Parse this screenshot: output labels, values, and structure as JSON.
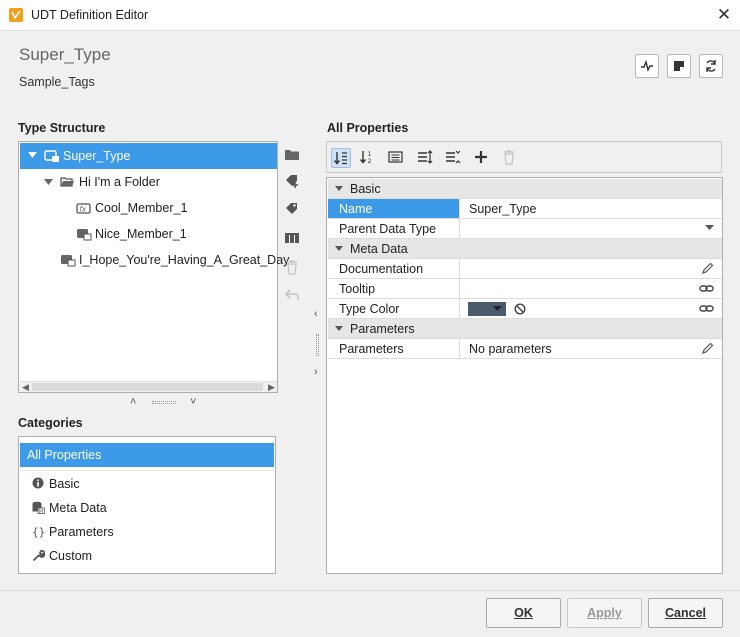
{
  "window": {
    "title": "UDT Definition Editor",
    "close": "✕"
  },
  "header": {
    "udt_name": "Super_Type",
    "tag_provider": "Sample_Tags"
  },
  "type_structure": {
    "label": "Type Structure",
    "nodes": [
      {
        "label": "Super_Type"
      },
      {
        "label": "Hi I'm a Folder"
      },
      {
        "label": "Cool_Member_1"
      },
      {
        "label": "Nice_Member_1"
      },
      {
        "label": "I_Hope_You're_Having_A_Great_Day"
      }
    ]
  },
  "categories": {
    "label": "Categories",
    "items": [
      {
        "label": "All Properties",
        "icon": "list-icon"
      },
      {
        "label": "Basic",
        "icon": "info-icon"
      },
      {
        "label": "Meta Data",
        "icon": "metadata-icon"
      },
      {
        "label": "Parameters",
        "icon": "braces-icon"
      },
      {
        "label": "Custom",
        "icon": "wrench-icon"
      }
    ]
  },
  "properties": {
    "label": "All Properties",
    "groups": [
      {
        "label": "Basic"
      },
      {
        "label": "Meta Data"
      },
      {
        "label": "Parameters"
      }
    ],
    "rows": {
      "name": {
        "label": "Name",
        "value": "Super_Type"
      },
      "parent": {
        "label": "Parent Data Type",
        "value": ""
      },
      "documentation": {
        "label": "Documentation",
        "value": ""
      },
      "tooltip": {
        "label": "Tooltip",
        "value": ""
      },
      "type_color": {
        "label": "Type Color",
        "value": ""
      },
      "parameters": {
        "label": "Parameters",
        "value": "No parameters"
      }
    }
  },
  "footer": {
    "ok": "OK",
    "apply": "Apply",
    "cancel": "Cancel"
  },
  "colors": {
    "selection": "#3d9ae8",
    "accent": "#f29f1c",
    "swatch": "#4a5b6e"
  }
}
